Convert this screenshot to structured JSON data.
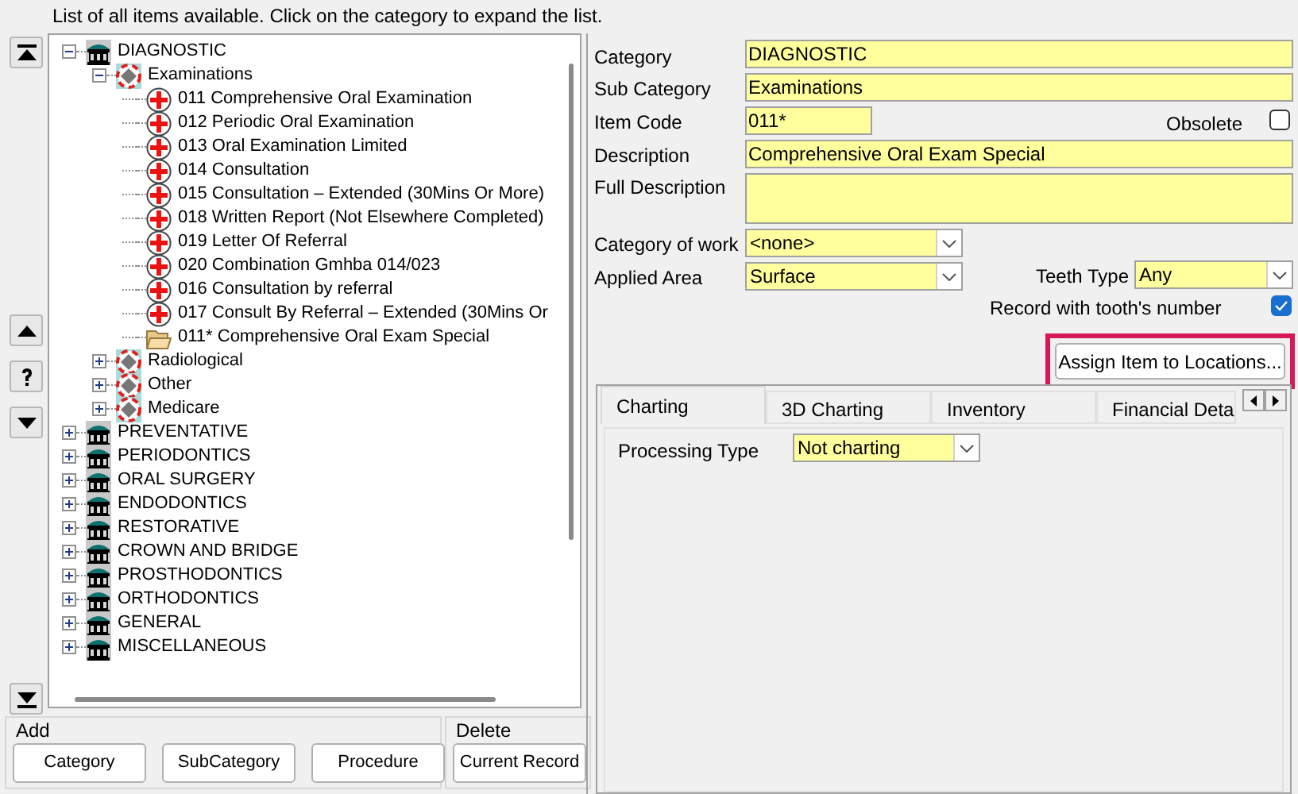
{
  "hint": "List of all items available. Click on the category to expand the list.",
  "tree": [
    {
      "kind": "category",
      "label": "DIAGNOSTIC",
      "expanded": true,
      "children": [
        {
          "kind": "subcategory",
          "label": "Examinations",
          "expanded": true,
          "children": [
            {
              "kind": "item",
              "label": "011 Comprehensive Oral Examination"
            },
            {
              "kind": "item",
              "label": "012 Periodic Oral Examination"
            },
            {
              "kind": "item",
              "label": "013 Oral Examination Limited"
            },
            {
              "kind": "item",
              "label": "014 Consultation"
            },
            {
              "kind": "item",
              "label": "015 Consultation – Extended (30Mins Or More)"
            },
            {
              "kind": "item",
              "label": "018 Written Report (Not Elsewhere Completed)"
            },
            {
              "kind": "item",
              "label": "019 Letter Of Referral"
            },
            {
              "kind": "item",
              "label": "020 Combination Gmhba 014/023"
            },
            {
              "kind": "item",
              "label": "016 Consultation by referral"
            },
            {
              "kind": "item",
              "label": "017 Consult By Referral – Extended  (30Mins Or"
            },
            {
              "kind": "new_item",
              "label": "011* Comprehensive Oral Exam Special"
            }
          ]
        },
        {
          "kind": "subcategory",
          "label": "Radiological",
          "expanded": false
        },
        {
          "kind": "subcategory",
          "label": "Other",
          "expanded": false
        },
        {
          "kind": "subcategory",
          "label": "Medicare",
          "expanded": false
        }
      ]
    },
    {
      "kind": "category",
      "label": "PREVENTATIVE",
      "expanded": false
    },
    {
      "kind": "category",
      "label": "PERIODONTICS",
      "expanded": false
    },
    {
      "kind": "category",
      "label": "ORAL SURGERY",
      "expanded": false
    },
    {
      "kind": "category",
      "label": "ENDODONTICS",
      "expanded": false
    },
    {
      "kind": "category",
      "label": "RESTORATIVE",
      "expanded": false
    },
    {
      "kind": "category",
      "label": "CROWN AND BRIDGE",
      "expanded": false
    },
    {
      "kind": "category",
      "label": "PROSTHODONTICS",
      "expanded": false
    },
    {
      "kind": "category",
      "label": "ORTHODONTICS",
      "expanded": false
    },
    {
      "kind": "category",
      "label": "GENERAL",
      "expanded": false
    },
    {
      "kind": "category",
      "label": "MISCELLANEOUS",
      "expanded": false
    }
  ],
  "add_group": {
    "title": "Add",
    "buttons": [
      "Category",
      "SubCategory",
      "Procedure"
    ]
  },
  "delete_group": {
    "title": "Delete",
    "buttons": [
      "Current Record"
    ]
  },
  "form": {
    "category": {
      "label": "Category",
      "value": "DIAGNOSTIC"
    },
    "sub_category": {
      "label": "Sub Category",
      "value": "Examinations"
    },
    "item_code": {
      "label": "Item Code",
      "value": "011*"
    },
    "obsolete": {
      "label": "Obsolete",
      "checked": false
    },
    "description": {
      "label": "Description",
      "value": "Comprehensive Oral Exam Special"
    },
    "full_description": {
      "label": "Full Description"
    },
    "category_of_work": {
      "label": "Category of work",
      "value": "<none>"
    },
    "applied_area": {
      "label": "Applied Area",
      "value": "Surface"
    },
    "teeth_type": {
      "label": "Teeth Type",
      "value": "Any"
    },
    "record_with_tooth_number": {
      "label": "Record with tooth's number",
      "checked": true
    }
  },
  "assign_button": {
    "label": "Assign Item to Locations...",
    "highlighted": true
  },
  "tabs": [
    {
      "label": "Charting",
      "selected": true
    },
    {
      "label": "3D Charting",
      "selected": false
    },
    {
      "label": "Inventory",
      "selected": false
    },
    {
      "label": "Financial Deta",
      "selected": false
    }
  ],
  "charting": {
    "processing_type": {
      "label": "Processing Type",
      "value": "Not charting"
    }
  }
}
